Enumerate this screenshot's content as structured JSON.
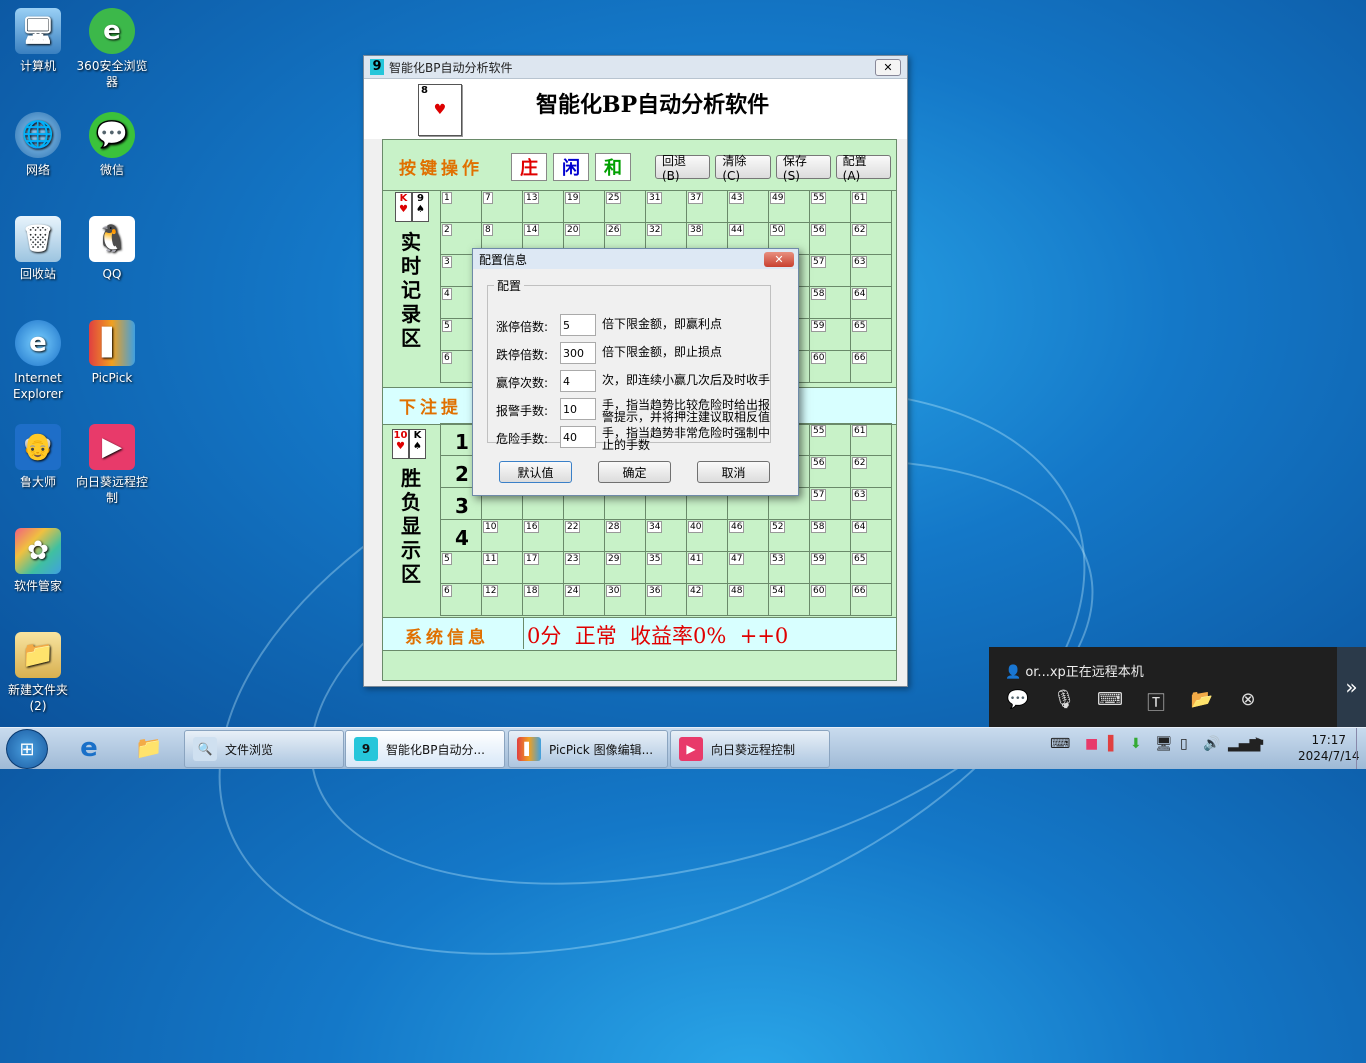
{
  "desktop": {
    "icons": [
      {
        "label": "计算机"
      },
      {
        "label": "360安全浏览器"
      },
      {
        "label": "网络"
      },
      {
        "label": "微信"
      },
      {
        "label": "回收站"
      },
      {
        "label": "QQ"
      },
      {
        "label": "Internet Explorer"
      },
      {
        "label": "PicPick"
      },
      {
        "label": "鲁大师"
      },
      {
        "label": "向日葵远程控制"
      },
      {
        "label": "软件管家"
      },
      {
        "label": "新建文件夹 (2)"
      }
    ]
  },
  "main_window": {
    "title": "智能化BP自动分析软件",
    "app_icon": "9",
    "header_title": "智能化BP自动分析软件",
    "button_section_label": "按键操作",
    "bet_buttons": [
      "庄",
      "闲",
      "和"
    ],
    "action_buttons": [
      "回退(B)",
      "清除(C)",
      "保存(S)",
      "配置(A)"
    ],
    "record_area_label": "实时记录区",
    "bet_hint_label": "下注提",
    "result_area_label": "胜负显示区",
    "result_rows": [
      "1",
      "2",
      "3",
      "4"
    ],
    "card_ranks_top": [
      "K",
      "9"
    ],
    "card_ranks_bottom": [
      "10",
      "K"
    ],
    "header_card_rank": "8",
    "status_label": "系统信息",
    "status_text": "0分  正常  收益率0%  ++0",
    "grid_numbers": [
      [
        "1",
        "7",
        "13",
        "19",
        "25",
        "31",
        "37",
        "43",
        "49",
        "55",
        "61"
      ],
      [
        "2",
        "8",
        "14",
        "20",
        "26",
        "32",
        "38",
        "44",
        "50",
        "56",
        "62"
      ],
      [
        "3",
        "",
        "",
        "",
        "",
        "",
        "",
        "",
        "",
        "57",
        "63"
      ],
      [
        "4",
        "",
        "",
        "",
        "",
        "",
        "",
        "",
        "",
        "58",
        "64"
      ],
      [
        "5",
        "",
        "",
        "",
        "",
        "",
        "",
        "",
        "",
        "59",
        "65"
      ],
      [
        "6",
        "",
        "",
        "",
        "",
        "",
        "",
        "",
        "",
        "60",
        "66"
      ]
    ],
    "grid2_numbers": [
      [
        "",
        "",
        "",
        "",
        "",
        "",
        "",
        "",
        "",
        "55",
        "61"
      ],
      [
        "",
        "",
        "",
        "",
        "",
        "",
        "",
        "",
        "",
        "56",
        "62"
      ],
      [
        "",
        "",
        "",
        "",
        "",
        "",
        "",
        "",
        "",
        "57",
        "63"
      ],
      [
        "",
        "10",
        "16",
        "22",
        "28",
        "34",
        "40",
        "46",
        "52",
        "58",
        "64"
      ],
      [
        "5",
        "11",
        "17",
        "23",
        "29",
        "35",
        "41",
        "47",
        "53",
        "59",
        "65"
      ],
      [
        "6",
        "12",
        "18",
        "24",
        "30",
        "36",
        "42",
        "48",
        "54",
        "60",
        "66"
      ]
    ]
  },
  "dialog": {
    "title": "配置信息",
    "group_label": "配置",
    "fields": [
      {
        "label": "涨停倍数:",
        "value": "5",
        "desc": "倍下限金额，即赢利点"
      },
      {
        "label": "跌停倍数:",
        "value": "300",
        "desc": "倍下限金额，即止损点"
      },
      {
        "label": "赢停次数:",
        "value": "4",
        "desc": "次，即连续小赢几次后及时收手"
      },
      {
        "label": "报警手数:",
        "value": "10",
        "desc": "手，指当趋势比较危险时给出报警提示，并将押注建议取相反值"
      },
      {
        "label": "危险手数:",
        "value": "40",
        "desc": "手，指当趋势非常危险时强制中止的手数"
      }
    ],
    "buttons": [
      "默认值",
      "确定",
      "取消"
    ]
  },
  "remote_panel": {
    "status": "or...xp正在远程本机"
  },
  "taskbar": {
    "items": [
      {
        "label": "文件浏览"
      },
      {
        "label": "智能化BP自动分..."
      },
      {
        "label": "PicPick 图像编辑..."
      },
      {
        "label": "向日葵远程控制"
      }
    ],
    "time": "17:17",
    "date": "2024/7/14"
  },
  "colors": {
    "board_green": "#c8f2c8",
    "hint_cyan": "#d8ffff",
    "orange_label": "#e07000",
    "status_red": "#e00000"
  }
}
